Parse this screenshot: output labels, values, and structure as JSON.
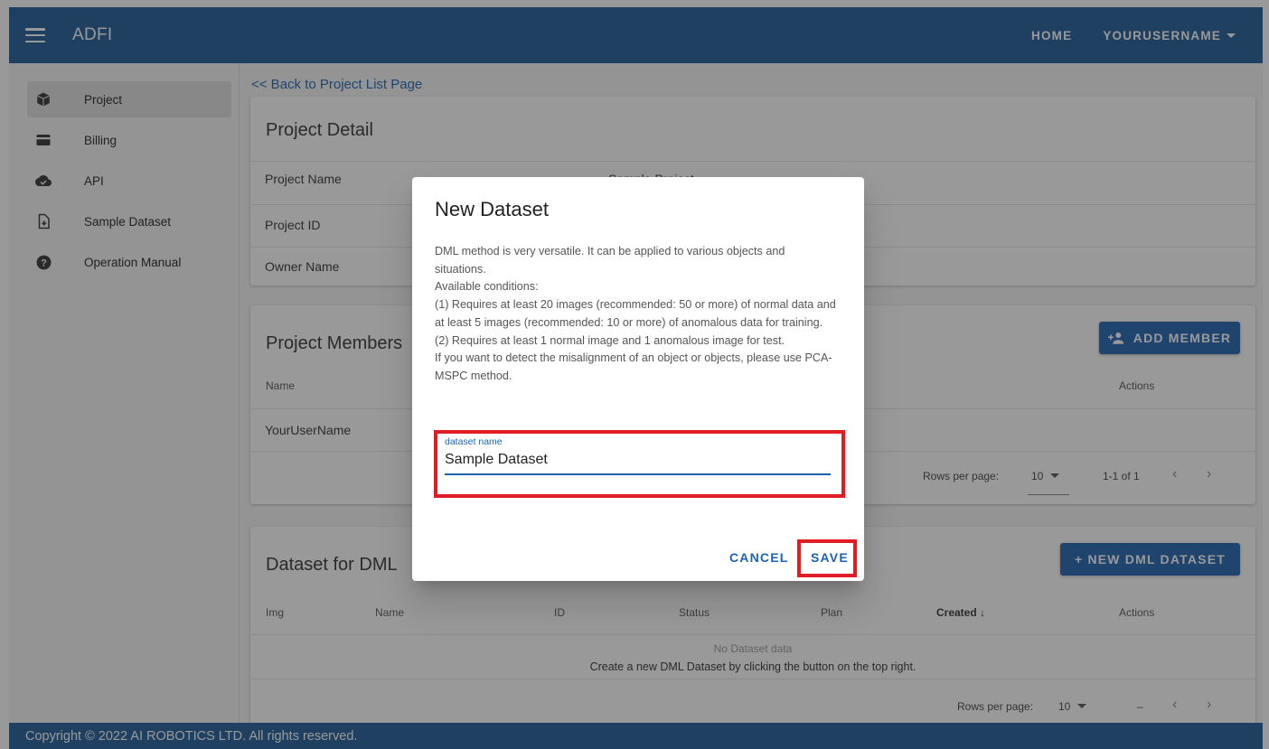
{
  "appbar": {
    "title": "ADFI",
    "home": "HOME",
    "user": "YOURUSERNAME"
  },
  "sidebar": {
    "items": [
      {
        "label": "Project",
        "icon": "box-icon"
      },
      {
        "label": "Billing",
        "icon": "credit-card-icon"
      },
      {
        "label": "API",
        "icon": "cloud-check-icon"
      },
      {
        "label": "Sample Dataset",
        "icon": "file-download-icon"
      },
      {
        "label": "Operation Manual",
        "icon": "help-circle-icon"
      }
    ]
  },
  "main": {
    "back_link": "<< Back to Project List Page",
    "project_detail": {
      "title": "Project Detail",
      "rows": [
        {
          "label": "Project Name",
          "value": "Sample Project"
        },
        {
          "label": "Project ID",
          "value": ""
        },
        {
          "label": "Owner Name",
          "value": ""
        }
      ]
    },
    "members": {
      "title": "Project Members",
      "add_button": "ADD MEMBER",
      "col_name": "Name",
      "col_actions": "Actions",
      "row_name": "YourUserName",
      "rows_per_page_label": "Rows per page:",
      "rows_per_page": "10",
      "range": "1-1 of 1"
    },
    "dml": {
      "title": "Dataset for DML",
      "new_button": "+ NEW DML DATASET",
      "columns": [
        "Img",
        "Name",
        "ID",
        "Status",
        "Plan",
        "Created ↓",
        "Actions"
      ],
      "empty_title": "No Dataset data",
      "empty_hint": "Create a new DML Dataset by clicking the button on the top right.",
      "rows_per_page_label": "Rows per page:",
      "rows_per_page": "10",
      "range": "–"
    }
  },
  "footer": {
    "text": "Copyright © 2022 AI ROBOTICS LTD. All rights reserved."
  },
  "dialog": {
    "title": "New Dataset",
    "body": [
      "DML method is very versatile. It can be applied to various objects and situations.",
      "Available conditions:",
      "(1) Requires at least 20 images (recommended: 50 or more) of normal data and at least 5 images (recommended: 10 or more) of anomalous data for training.",
      "(2) Requires at least 1 normal image and 1 anomalous image for test.",
      "If you want to detect the misalignment of an object or objects, please use PCA-MSPC method."
    ],
    "field_label": "dataset name",
    "field_value": "Sample Dataset",
    "cancel": "CANCEL",
    "save": "SAVE"
  },
  "colors": {
    "primary": "#1f5b96",
    "accent": "#1e63b0",
    "highlight": "#e01c24"
  }
}
